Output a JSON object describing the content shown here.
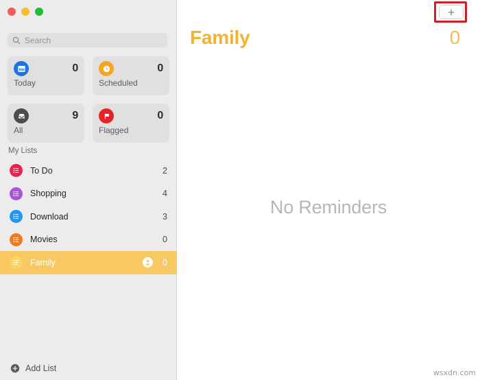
{
  "window": {
    "traffic_lights": [
      {
        "name": "close",
        "color": "#f15c54"
      },
      {
        "name": "minimize",
        "color": "#f7bd2e"
      },
      {
        "name": "maximize",
        "color": "#1bbf36"
      }
    ]
  },
  "sidebar": {
    "search": {
      "placeholder": "Search",
      "value": "",
      "icon": "search-icon"
    },
    "smart_lists": [
      {
        "id": "today",
        "label": "Today",
        "count": "0",
        "icon": "calendar-icon",
        "color": "#1b73e8"
      },
      {
        "id": "scheduled",
        "label": "Scheduled",
        "count": "0",
        "icon": "clock-icon",
        "color": "#f5a623"
      },
      {
        "id": "all",
        "label": "All",
        "count": "9",
        "icon": "inbox-icon",
        "color": "#4c4c4c"
      },
      {
        "id": "flagged",
        "label": "Flagged",
        "count": "0",
        "icon": "flag-icon",
        "color": "#e52428"
      }
    ],
    "section_title": "My Lists",
    "lists": [
      {
        "id": "todo",
        "label": "To Do",
        "count": "2",
        "color": "#e6254f",
        "shared": false,
        "selected": false
      },
      {
        "id": "shopping",
        "label": "Shopping",
        "count": "4",
        "color": "#a855d8",
        "shared": false,
        "selected": false
      },
      {
        "id": "download",
        "label": "Download",
        "count": "3",
        "color": "#2196f3",
        "shared": false,
        "selected": false
      },
      {
        "id": "movies",
        "label": "Movies",
        "count": "0",
        "color": "#f07b1e",
        "shared": false,
        "selected": false
      },
      {
        "id": "family",
        "label": "Family",
        "count": "0",
        "color": "#fcd462",
        "shared": true,
        "selected": true
      }
    ],
    "add_list": {
      "label": "Add List",
      "icon": "plus-circle-icon"
    }
  },
  "main": {
    "title": "Family",
    "count": "0",
    "add_reminder_button": {
      "label": "+",
      "icon": "plus-icon"
    },
    "empty_state": "No Reminders",
    "highlight_color": "#cc2027",
    "accent_color": "#f2b335"
  },
  "watermark": "wsxdn.com"
}
